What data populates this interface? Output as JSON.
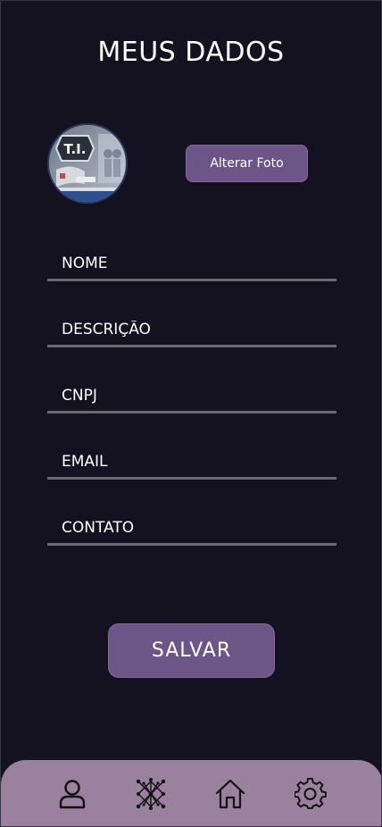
{
  "header": {
    "title": "MEUS DADOS"
  },
  "profile": {
    "change_photo_label": "Alterar Foto",
    "avatar_badge_text": "T.I."
  },
  "form": {
    "fields": [
      {
        "key": "nome",
        "placeholder": "NOME",
        "value": ""
      },
      {
        "key": "descricao",
        "placeholder": "DESCRIÇÃO",
        "value": ""
      },
      {
        "key": "cnpj",
        "placeholder": "CNPJ",
        "value": ""
      },
      {
        "key": "email",
        "placeholder": "EMAIL",
        "value": ""
      },
      {
        "key": "contato",
        "placeholder": "CONTATO",
        "value": ""
      }
    ],
    "save_label": "SALVAR"
  },
  "bottom_nav": {
    "items": [
      {
        "icon": "user-icon"
      },
      {
        "icon": "network-icon"
      },
      {
        "icon": "home-icon"
      },
      {
        "icon": "gear-icon"
      }
    ]
  },
  "colors": {
    "background": "#141121",
    "accent": "#6c5587",
    "nav_background": "#9a829f",
    "underline": "#6b6873",
    "text": "#ffffff"
  }
}
